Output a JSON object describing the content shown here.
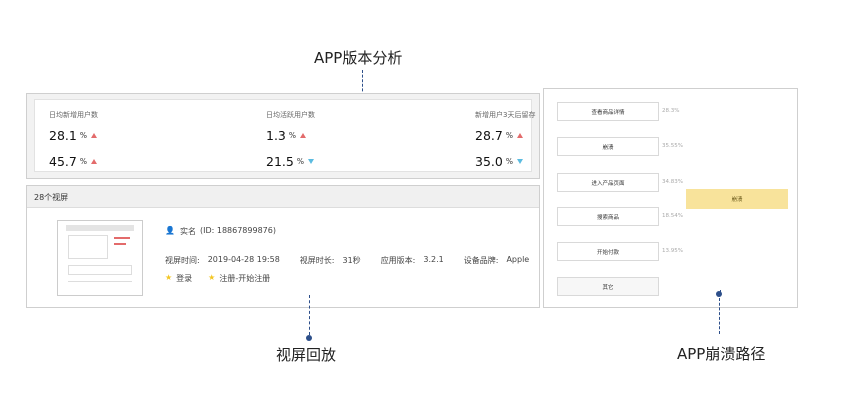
{
  "callouts": {
    "version_analysis": "APP版本分析",
    "screen_replay": "视屏回放",
    "crash_path": "APP崩溃路径"
  },
  "stats": {
    "columns": [
      {
        "header": "日均新增用户数",
        "values": [
          {
            "value": "28.1",
            "unit": "%",
            "trend": "up"
          },
          {
            "value": "45.7",
            "unit": "%",
            "trend": "up"
          }
        ]
      },
      {
        "header": "日均活跃用户数",
        "values": [
          {
            "value": "1.3",
            "unit": "%",
            "trend": "up"
          },
          {
            "value": "21.5",
            "unit": "%",
            "trend": "down"
          }
        ]
      },
      {
        "header": "新增用户3天后留存",
        "values": [
          {
            "value": "28.7",
            "unit": "%",
            "trend": "up"
          },
          {
            "value": "35.0",
            "unit": "%",
            "trend": "down"
          }
        ]
      }
    ]
  },
  "recording": {
    "header": "28个视屏",
    "user_name": "实名",
    "user_id": "(ID: 18867899876)",
    "time_label": "视屏时间:",
    "time_value": "2019-04-28 19:58",
    "duration_label": "视屏时长:",
    "duration_value": "31秒",
    "version_label": "应用版本:",
    "version_value": "3.2.1",
    "brand_label": "设备品牌:",
    "brand_value": "Apple",
    "tag1": "登录",
    "tag2": "注册-开始注册"
  },
  "crash_path": {
    "nodes": [
      {
        "label": "查看商品详情",
        "pct": "28.3%"
      },
      {
        "label": "崩溃",
        "pct": "35.55%"
      },
      {
        "label": "进入产品页面",
        "pct": "34.83%"
      },
      {
        "label": "搜索商品",
        "pct": "18.54%"
      },
      {
        "label": "开始付款",
        "pct": "13.95%"
      },
      {
        "label": "其它",
        "pct": ""
      }
    ],
    "crash_label": "崩溃"
  },
  "colors": {
    "trend_up": "#e36b6b",
    "trend_down": "#5bbbe0",
    "crash_highlight": "#f8e39b",
    "callout_line": "#2d4f8a",
    "star": "#f3c623"
  }
}
